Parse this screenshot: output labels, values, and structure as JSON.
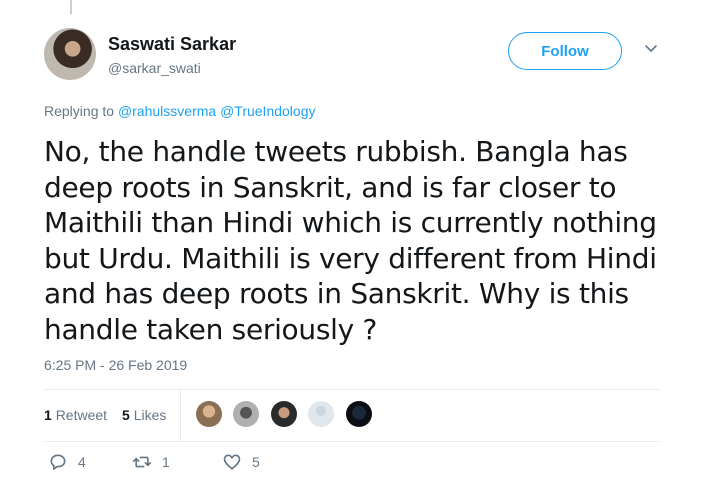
{
  "tweet": {
    "author_name": "Saswati Sarkar",
    "author_handle": "@sarkar_swati",
    "follow_label": "Follow",
    "replying_prefix": "Replying to",
    "replying_users": [
      "@rahulssverma",
      "@TrueIndology"
    ],
    "text": "No, the handle tweets rubbish. Bangla has deep roots in Sanskrit, and is far closer to Maithili than Hindi which is currently nothing but Urdu. Maithili is very different from Hindi and has deep roots in Sanskrit. Why is this handle taken seriously ?",
    "timestamp": "6:25 PM - 26 Feb 2019"
  },
  "stats": {
    "retweet_count": "1",
    "retweet_label": "Retweet",
    "like_count": "5",
    "like_label": "Likes"
  },
  "actions": {
    "reply_count": "4",
    "retweet_count": "1",
    "like_count": "5"
  },
  "colors": {
    "accent": "#1da1f2",
    "muted": "#657786"
  },
  "icons": [
    "reply-icon",
    "retweet-icon",
    "heart-icon",
    "chevron-down-icon"
  ]
}
